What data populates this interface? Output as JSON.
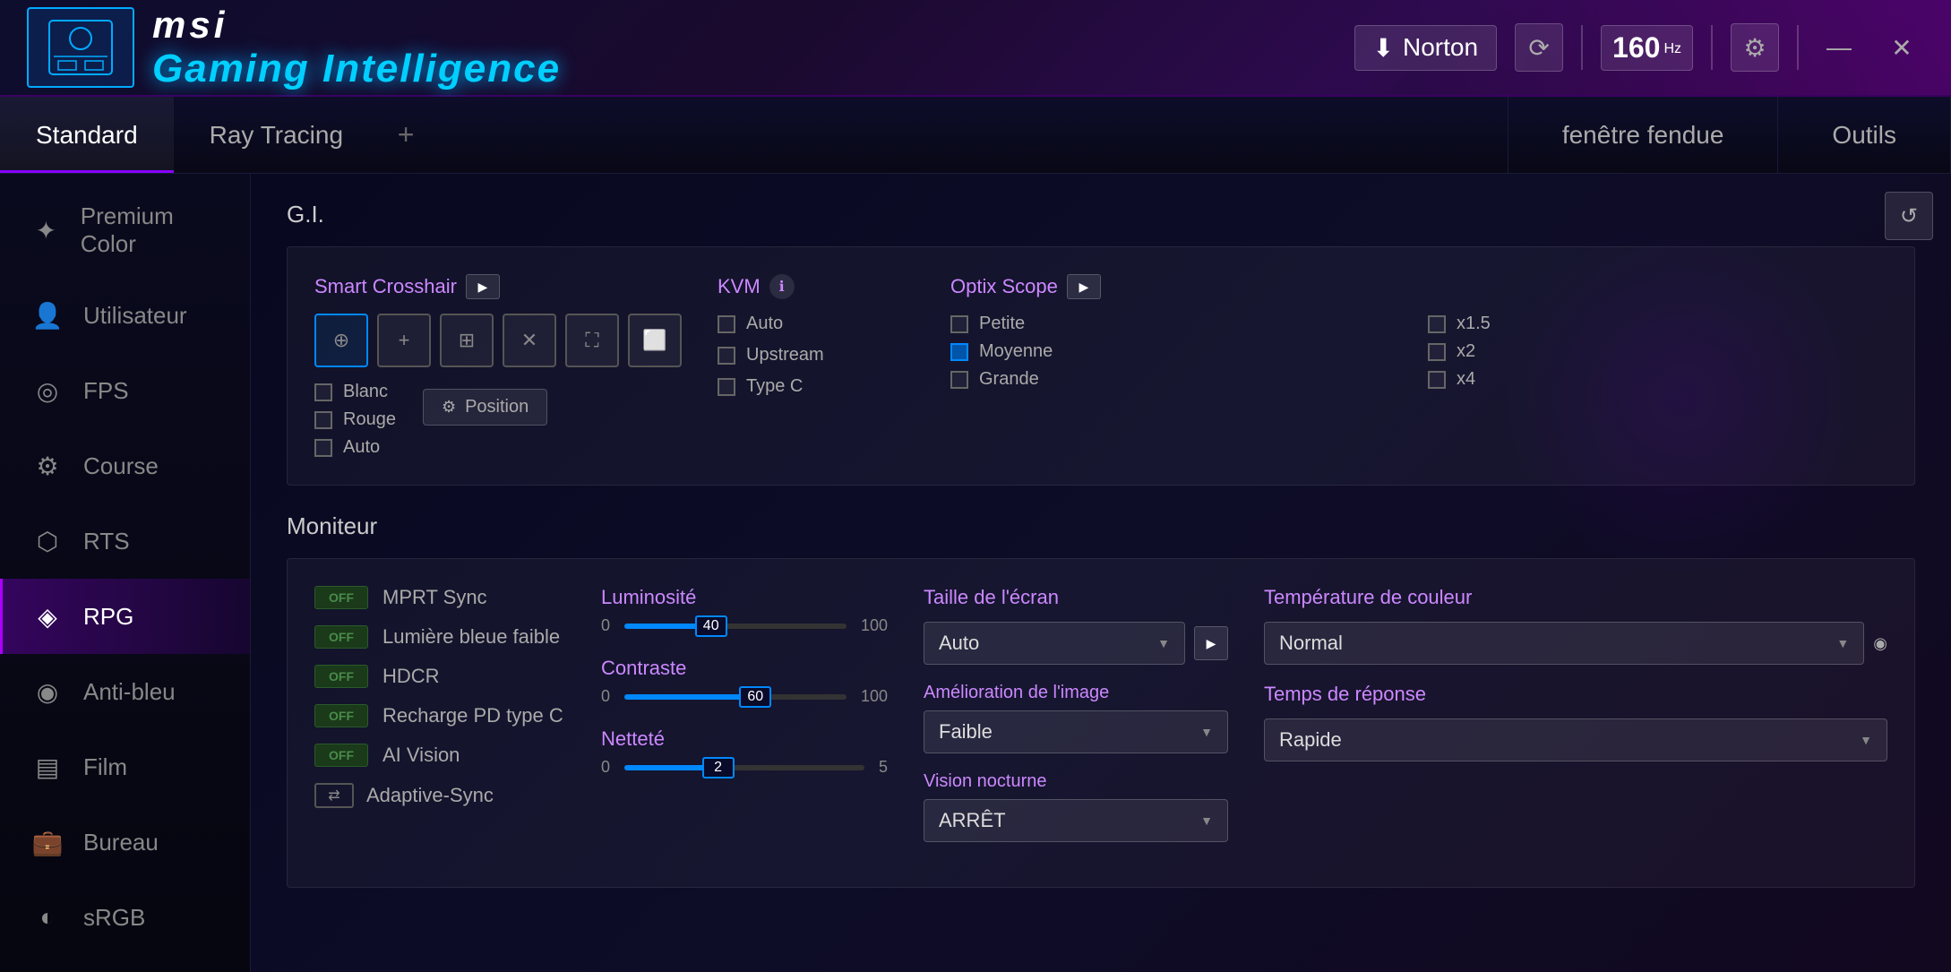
{
  "titleBar": {
    "brand": "msi",
    "brandSub": "Gaming Intelligence",
    "nortonLabel": "Norton",
    "hzValue": "160",
    "hzUnit": "Hz"
  },
  "tabs": {
    "items": [
      {
        "label": "Standard",
        "active": true
      },
      {
        "label": "Ray Tracing",
        "active": false
      }
    ],
    "addLabel": "+",
    "rightItems": [
      {
        "label": "fenêtre fendue"
      },
      {
        "label": "Outils"
      }
    ]
  },
  "sidebar": {
    "items": [
      {
        "label": "Premium Color",
        "icon": "✦"
      },
      {
        "label": "Utilisateur",
        "icon": "👤"
      },
      {
        "label": "FPS",
        "icon": "◎"
      },
      {
        "label": "Course",
        "icon": "⚙"
      },
      {
        "label": "RTS",
        "icon": "⬡"
      },
      {
        "label": "RPG",
        "icon": "◈",
        "active": true
      },
      {
        "label": "Anti-bleu",
        "icon": "◉"
      },
      {
        "label": "Film",
        "icon": "▤"
      },
      {
        "label": "Bureau",
        "icon": "💼"
      },
      {
        "label": "sRGB",
        "icon": "◐"
      }
    ]
  },
  "content": {
    "refreshLabel": "↺",
    "giTitle": "G.I.",
    "smartCrosshair": {
      "label": "Smart Crosshair",
      "playBtn": "▶",
      "crosshairIcons": [
        "⊕",
        "+",
        "⊞",
        "✕",
        "⛶",
        "⬜"
      ],
      "colorOptions": [
        {
          "label": "Blanc"
        },
        {
          "label": "Rouge"
        },
        {
          "label": "Auto"
        }
      ],
      "positionLabel": "Position"
    },
    "kvm": {
      "label": "KVM",
      "options": [
        "Auto",
        "Upstream",
        "Type C"
      ]
    },
    "optixScope": {
      "label": "Optix Scope",
      "playBtn": "▶",
      "leftOptions": [
        "Petite",
        "Moyenne",
        "Grande"
      ],
      "rightOptions": [
        "x1.5",
        "x2",
        "x4"
      ]
    },
    "monitorTitle": "Moniteur",
    "monitor": {
      "toggles": [
        {
          "label": "MPRT Sync"
        },
        {
          "label": "Lumière bleue faible"
        },
        {
          "label": "HDCR"
        },
        {
          "label": "Recharge PD type C"
        },
        {
          "label": "AI Vision"
        }
      ],
      "adaptiveSyncLabel": "Adaptive-Sync",
      "sliders": [
        {
          "label": "Luminosité",
          "min": 0,
          "max": 100,
          "value": 40,
          "fillPct": 40
        },
        {
          "label": "Contraste",
          "min": 0,
          "max": 100,
          "value": 60,
          "fillPct": 60
        },
        {
          "label": "Netteté",
          "min": 0,
          "max": 5,
          "value": 2,
          "fillPct": 40
        }
      ],
      "tailleEcranLabel": "Taille de l'écran",
      "tailleValue": "Auto",
      "ameliorationLabel": "Amélioration de l'image",
      "ameliorationValue": "Faible",
      "visionNocturneLabel": "Vision nocturne",
      "visionValue": "ARRÊT",
      "temperatureLabel": "Température de couleur",
      "temperatureValue": "Normal",
      "tempsReponseLabel": "Temps de réponse",
      "tempsReponseValue": "Rapide"
    }
  }
}
